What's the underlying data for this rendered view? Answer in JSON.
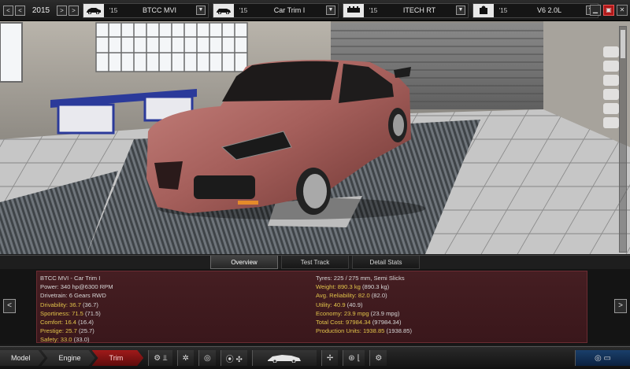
{
  "topbar": {
    "year": "2015",
    "prev_label": "<",
    "prev_prev_label": "<",
    "next_label": ">",
    "next_next_label": ">",
    "model": {
      "year": "'15",
      "name": "BTCC MVI"
    },
    "trim": {
      "year": "'15",
      "name": "Car Trim I"
    },
    "engine": {
      "year": "'15",
      "name": "ITECH RT"
    },
    "variant": {
      "year": "'15",
      "name": "V6 2.0L"
    },
    "dropdown_glyph": "▼"
  },
  "tabs": [
    "Overview",
    "Test Track",
    "Detail Stats"
  ],
  "info": {
    "left": [
      {
        "label": "BTCC MVI - Car Trim I",
        "value": "",
        "base": "",
        "highlight": false
      },
      {
        "label": "Power: ",
        "value": "340 hp@6300 RPM",
        "base": "",
        "highlight": false
      },
      {
        "label": "Drivetrain: ",
        "value": "6 Gears RWD",
        "base": "",
        "highlight": false
      },
      {
        "label": "Drivability: ",
        "value": "36.7",
        "base": " (36.7)",
        "highlight": true
      },
      {
        "label": "Sportiness: ",
        "value": "71.5",
        "base": " (71.5)",
        "highlight": true
      },
      {
        "label": "Comfort: ",
        "value": "16.4",
        "base": " (16.4)",
        "highlight": true
      },
      {
        "label": "Prestige: ",
        "value": "25.7",
        "base": " (25.7)",
        "highlight": true
      },
      {
        "label": "Safety: ",
        "value": "33.0",
        "base": " (33.0)",
        "highlight": true
      }
    ],
    "right": [
      {
        "label": "Tyres: ",
        "value": "225 / 275 mm, Semi Slicks",
        "base": "",
        "highlight": false
      },
      {
        "label": "Weight: ",
        "value": "890.3 kg",
        "base": " (890.3 kg)",
        "highlight": true
      },
      {
        "label": "Avg. Reliability: ",
        "value": "82.0",
        "base": " (82.0)",
        "highlight": true
      },
      {
        "label": "Utility: ",
        "value": "40.9",
        "base": " (40.9)",
        "highlight": true
      },
      {
        "label": "Economy: ",
        "value": "23.9 mpg",
        "base": " (23.9 mpg)",
        "highlight": true
      },
      {
        "label": "Total Cost: ",
        "value": "97984.34",
        "base": " (97984.34)",
        "highlight": true
      },
      {
        "label": "Production Units: ",
        "value": "1938.85",
        "base": " (1938.85)",
        "highlight": true
      }
    ],
    "prev_label": "<",
    "next_label": ">"
  },
  "bottom_nav": {
    "stages": [
      "Model",
      "Engine",
      "Trim"
    ],
    "active_stage": "Trim",
    "icons": [
      "gearbox-icon",
      "suspension-icon",
      "brakes-icon",
      "tyre-icon",
      "fan-icon",
      "body-icon",
      "steering-icon",
      "seat-icon",
      "settings-icon",
      "overview-icon"
    ]
  },
  "colors": {
    "accent_red": "#a01a1a",
    "highlight_yellow": "#e0c24a",
    "panel_bg": "#451e22",
    "active_blue": "#1a3f6a"
  }
}
